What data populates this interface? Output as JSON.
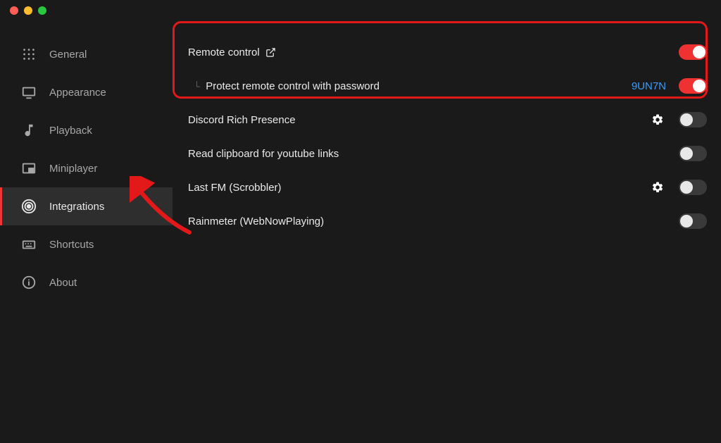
{
  "sidebar": {
    "items": [
      {
        "label": "General",
        "icon": "grid-icon",
        "active": false
      },
      {
        "label": "Appearance",
        "icon": "monitor-icon",
        "active": false
      },
      {
        "label": "Playback",
        "icon": "music-note-icon",
        "active": false
      },
      {
        "label": "Miniplayer",
        "icon": "miniplayer-icon",
        "active": false
      },
      {
        "label": "Integrations",
        "icon": "broadcast-icon",
        "active": true
      },
      {
        "label": "Shortcuts",
        "icon": "keyboard-icon",
        "active": false
      },
      {
        "label": "About",
        "icon": "info-icon",
        "active": false
      }
    ]
  },
  "settings": {
    "remote_control": {
      "label": "Remote control",
      "enabled": true
    },
    "protect_password": {
      "label": "Protect remote control with password",
      "code": "9UN7N",
      "enabled": true
    },
    "discord": {
      "label": "Discord Rich Presence",
      "has_gear": true,
      "enabled": false
    },
    "clipboard": {
      "label": "Read clipboard for youtube links",
      "enabled": false
    },
    "lastfm": {
      "label": "Last FM (Scrobbler)",
      "has_gear": true,
      "enabled": false
    },
    "rainmeter": {
      "label": "Rainmeter (WebNowPlaying)",
      "enabled": false
    }
  },
  "colors": {
    "accent": "#f03131",
    "link": "#3a9cff",
    "highlight_border": "#e31919"
  }
}
